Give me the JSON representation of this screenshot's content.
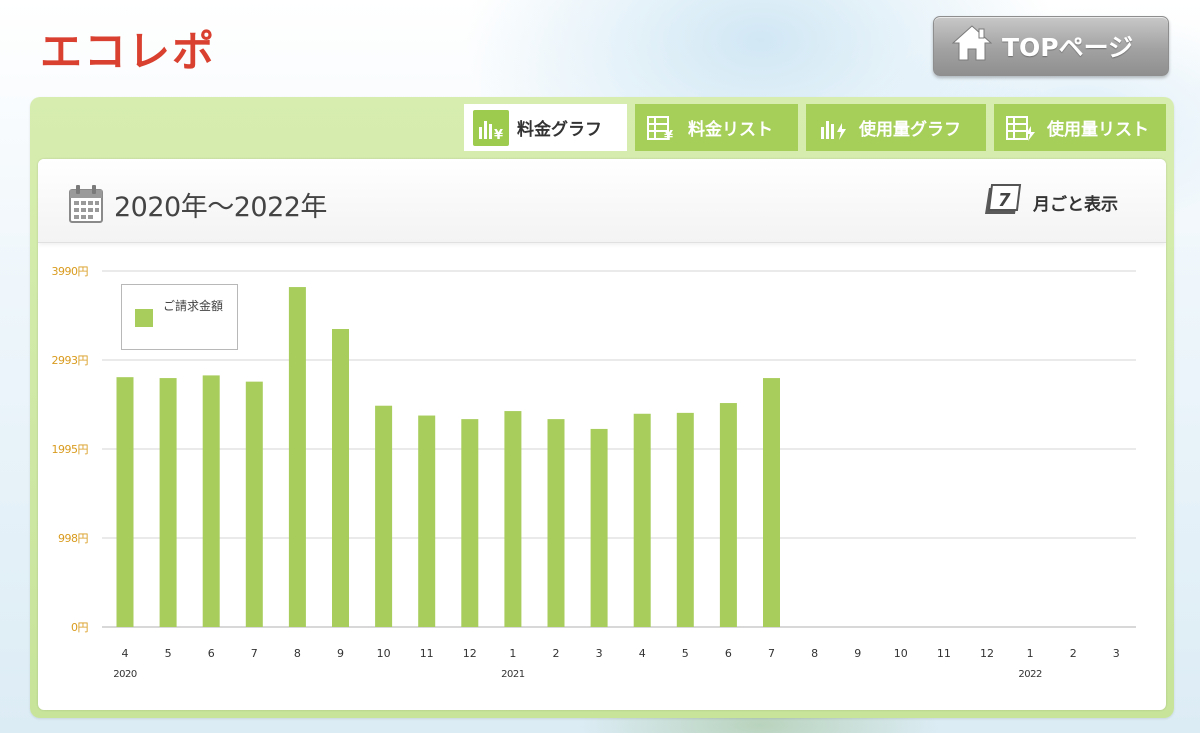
{
  "app": {
    "logo_text": "エコレポ"
  },
  "header": {
    "top_button_label": "TOPページ",
    "top_button_icon": "home-icon"
  },
  "tabs": [
    {
      "label": "料金グラフ",
      "icon": "bar-yen-icon",
      "active": true
    },
    {
      "label": "料金リスト",
      "icon": "list-yen-icon",
      "active": false
    },
    {
      "label": "使用量グラフ",
      "icon": "bar-bolt-icon",
      "active": false
    },
    {
      "label": "使用量リスト",
      "icon": "list-bolt-icon",
      "active": false
    }
  ],
  "card": {
    "period": "2020年〜2022年",
    "period_icon": "calendar-icon",
    "monthly_label": "月ごと表示",
    "monthly_icon": "calendar-day-icon"
  },
  "colors": {
    "accent": "#a8cd5c",
    "brand_red": "#d9402f",
    "tick_label": "#d99b1e"
  },
  "chart_data": {
    "type": "bar",
    "legend": "ご請求金額",
    "legend_placement": "top-left",
    "grid": true,
    "ylim": [
      0,
      3990
    ],
    "y_ticks": [
      {
        "value": 0,
        "label": "0円"
      },
      {
        "value": 998,
        "label": "998円"
      },
      {
        "value": 1995,
        "label": "1995円"
      },
      {
        "value": 2993,
        "label": "2993円"
      },
      {
        "value": 3990,
        "label": "3990円"
      }
    ],
    "categories": [
      "4",
      "5",
      "6",
      "7",
      "8",
      "9",
      "10",
      "11",
      "12",
      "1",
      "2",
      "3",
      "4",
      "5",
      "6",
      "7",
      "8",
      "9",
      "10",
      "11",
      "12",
      "1",
      "2",
      "3"
    ],
    "year_labels": [
      {
        "index": 0,
        "label": "2020"
      },
      {
        "index": 9,
        "label": "2021"
      },
      {
        "index": 21,
        "label": "2022"
      }
    ],
    "series": [
      {
        "name": "ご請求金額",
        "values": [
          2800,
          2790,
          2820,
          2750,
          3810,
          3340,
          2480,
          2370,
          2330,
          2420,
          2330,
          2220,
          2390,
          2400,
          2510,
          2790,
          null,
          null,
          null,
          null,
          null,
          null,
          null,
          null
        ]
      }
    ]
  }
}
